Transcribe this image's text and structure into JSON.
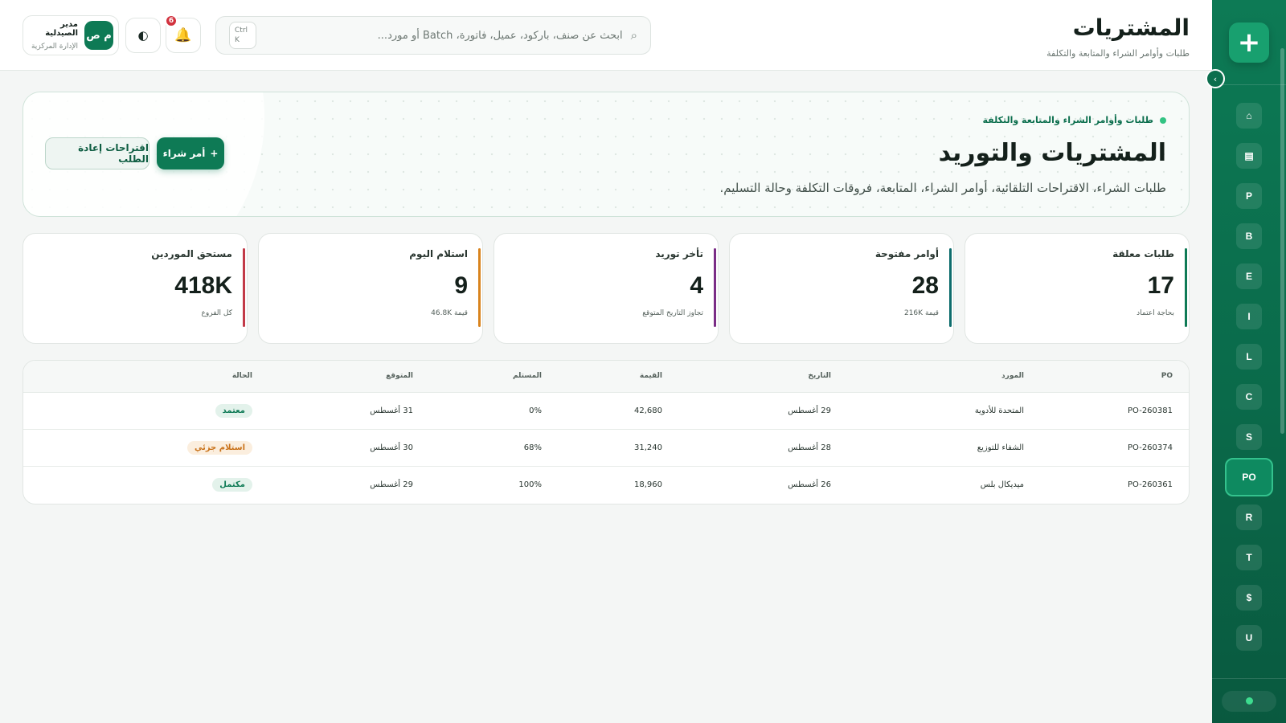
{
  "sidebar": {
    "logo_symbol": "+",
    "items": [
      {
        "label": "⌂",
        "name": "sidebar-item-home"
      },
      {
        "label": "▤",
        "name": "sidebar-item-inventory"
      },
      {
        "label": "P",
        "name": "sidebar-item-p"
      },
      {
        "label": "B",
        "name": "sidebar-item-b"
      },
      {
        "label": "E",
        "name": "sidebar-item-e"
      },
      {
        "label": "I",
        "name": "sidebar-item-i"
      },
      {
        "label": "L",
        "name": "sidebar-item-l"
      },
      {
        "label": "C",
        "name": "sidebar-item-c"
      },
      {
        "label": "S",
        "name": "sidebar-item-s"
      },
      {
        "label": "PO",
        "name": "sidebar-item-po",
        "active": true
      },
      {
        "label": "R",
        "name": "sidebar-item-r"
      },
      {
        "label": "T",
        "name": "sidebar-item-t"
      },
      {
        "label": "$",
        "name": "sidebar-item-finance"
      },
      {
        "label": "U",
        "name": "sidebar-item-u"
      }
    ],
    "collapse_symbol": "›"
  },
  "header": {
    "title": "المشتريات",
    "subtitle": "طلبات وأوامر الشراء والمتابعة والتكلفة",
    "search_placeholder": "ابحث عن صنف، باركود، عميل، فاتورة، Batch أو مورد...",
    "search_icon": "⌕",
    "shortcut_line1": "Ctrl",
    "shortcut_line2": "K",
    "notifications_count": "6",
    "bell_icon": "🔔",
    "theme_icon": "◐",
    "user": {
      "initials": "م ص",
      "name": "مدير الصيدلية",
      "role": "الإدارة المركزية"
    }
  },
  "hero": {
    "kicker": "طلبات وأوامر الشراء والمتابعة والتكلفة",
    "title": "المشتريات والتوريد",
    "description": "طلبات الشراء، الاقتراحات التلقائية، أوامر الشراء، المتابعة، فروقات التكلفة وحالة التسليم.",
    "primary_button": "أمر شراء",
    "primary_button_icon": "+",
    "secondary_button": "اقتراحات إعادة الطلب"
  },
  "stats": [
    {
      "label": "طلبات معلقة",
      "value": "17",
      "sub": "بحاجة اعتماد",
      "color": "#0e7a55"
    },
    {
      "label": "أوامر مفتوحة",
      "value": "28",
      "sub": "قيمة 216K",
      "color": "#0e6d6d"
    },
    {
      "label": "تأخر توريد",
      "value": "4",
      "sub": "تجاوز التاريخ المتوقع",
      "color": "#7a2d86"
    },
    {
      "label": "استلام اليوم",
      "value": "9",
      "sub": "قيمة 46.8K",
      "color": "#d9831d"
    },
    {
      "label": "مستحق الموردين",
      "value": "418K",
      "sub": "كل الفروع",
      "color": "#c23a48"
    }
  ],
  "table": {
    "columns": [
      "PO",
      "المورد",
      "التاريخ",
      "القيمة",
      "المستلم",
      "المتوقع",
      "الحالة"
    ],
    "rows": [
      {
        "po": "PO-260381",
        "supplier": "المتحدة للأدوية",
        "date": "29 أغسطس",
        "value": "42,680",
        "received": "0%",
        "expected": "31 أغسطس",
        "status": "معتمد",
        "status_color": "#0e7a55",
        "status_bg": "#e3f2eb"
      },
      {
        "po": "PO-260374",
        "supplier": "الشفاء للتوزيع",
        "date": "28 أغسطس",
        "value": "31,240",
        "received": "68%",
        "expected": "30 أغسطس",
        "status": "استلام جزئي",
        "status_color": "#c9721a",
        "status_bg": "#fbeede"
      },
      {
        "po": "PO-260361",
        "supplier": "ميديكال بلس",
        "date": "26 أغسطس",
        "value": "18,960",
        "received": "100%",
        "expected": "29 أغسطس",
        "status": "مكتمل",
        "status_color": "#0e7a55",
        "status_bg": "#e3f2eb"
      }
    ]
  }
}
